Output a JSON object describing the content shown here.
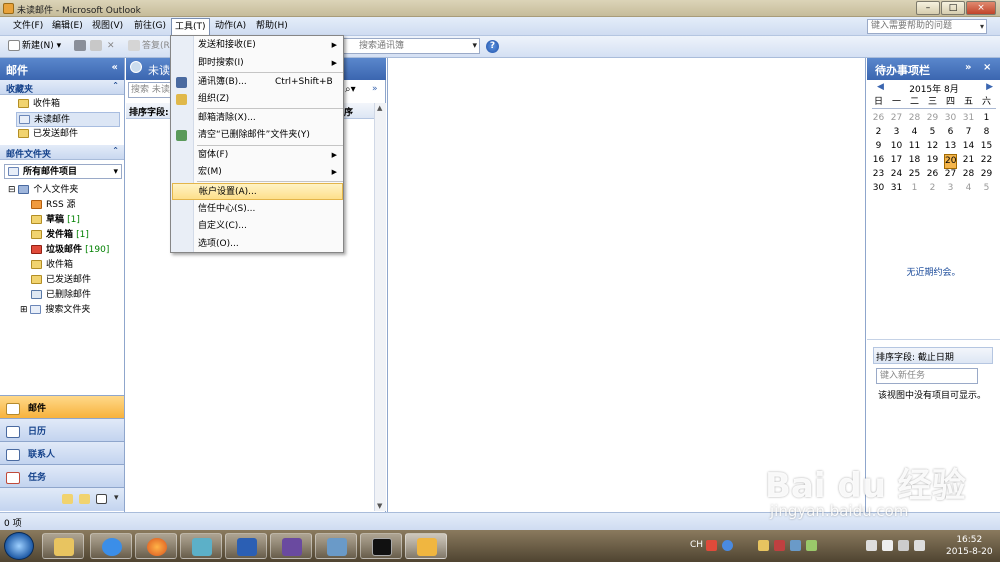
{
  "window": {
    "title": "未读邮件 - Microsoft Outlook",
    "min": "–",
    "max": "□",
    "close": "×"
  },
  "menubar": {
    "items": [
      "文件(F)",
      "编辑(E)",
      "视图(V)",
      "前往(G)",
      "工具(T)",
      "动作(A)",
      "帮助(H)"
    ],
    "help_placeholder": "键入需要帮助的问题"
  },
  "toolbar": {
    "new_label": "新建(N)",
    "reply_label": "答复(R)",
    "search_address": "搜索通讯簿"
  },
  "nav": {
    "title": "邮件",
    "favorites_title": "收藏夹",
    "favorites": [
      "收件箱",
      "未读邮件",
      "已发送邮件"
    ],
    "folders_title": "邮件文件夹",
    "all_items": "所有邮件项目",
    "personal": "个人文件夹",
    "folders": [
      {
        "name": "RSS 源",
        "count": ""
      },
      {
        "name": "草稿",
        "count": "[1]"
      },
      {
        "name": "发件箱",
        "count": "[1]"
      },
      {
        "name": "垃圾邮件",
        "count": "[190]"
      },
      {
        "name": "收件箱",
        "count": ""
      },
      {
        "name": "已发送邮件",
        "count": ""
      },
      {
        "name": "已删除邮件",
        "count": ""
      },
      {
        "name": "搜索文件夹",
        "count": ""
      }
    ],
    "buttons": [
      "邮件",
      "日历",
      "联系人",
      "任务"
    ]
  },
  "list": {
    "title": "未读",
    "search_placeholder": "搜索 未读",
    "sort_label": "排序字段:",
    "sort_right": "序"
  },
  "tools_menu": {
    "items": [
      {
        "label": "发送和接收(E)",
        "shortcut": "",
        "submenu": true
      },
      {
        "label": "即时搜索(I)",
        "shortcut": "",
        "submenu": true
      },
      {
        "label": "通讯簿(B)...",
        "shortcut": "Ctrl+Shift+B",
        "submenu": false
      },
      {
        "label": "组织(Z)",
        "shortcut": "",
        "submenu": false
      },
      {
        "label": "邮箱清除(X)...",
        "shortcut": "",
        "submenu": false
      },
      {
        "label": "清空“已删除邮件”文件夹(Y)",
        "shortcut": "",
        "submenu": false
      },
      {
        "label": "窗体(F)",
        "shortcut": "",
        "submenu": true
      },
      {
        "label": "宏(M)",
        "shortcut": "",
        "submenu": true
      },
      {
        "label": "帐户设置(A)...",
        "shortcut": "",
        "submenu": false
      },
      {
        "label": "信任中心(S)...",
        "shortcut": "",
        "submenu": false
      },
      {
        "label": "自定义(C)...",
        "shortcut": "",
        "submenu": false
      },
      {
        "label": "选项(O)...",
        "shortcut": "",
        "submenu": false
      }
    ]
  },
  "todo": {
    "title": "待办事项栏",
    "month": "2015年 8月",
    "weekdays": [
      "日",
      "一",
      "二",
      "三",
      "四",
      "五",
      "六"
    ],
    "weeks": [
      [
        "26",
        "27",
        "28",
        "29",
        "30",
        "31",
        "1"
      ],
      [
        "2",
        "3",
        "4",
        "5",
        "6",
        "7",
        "8"
      ],
      [
        "9",
        "10",
        "11",
        "12",
        "13",
        "14",
        "15"
      ],
      [
        "16",
        "17",
        "18",
        "19",
        "20",
        "21",
        "22"
      ],
      [
        "23",
        "24",
        "25",
        "26",
        "27",
        "28",
        "29"
      ],
      [
        "30",
        "31",
        "1",
        "2",
        "3",
        "4",
        "5"
      ]
    ],
    "no_appointments": "无近期约会。",
    "task_sort": "排序字段: 截止日期",
    "new_task_placeholder": "键入新任务",
    "no_items": "该视图中没有项目可显示。"
  },
  "statusbar": {
    "text": "0 项"
  },
  "taskbar": {
    "lang": "CH",
    "time": "16:52",
    "date": "2015-8-20"
  },
  "watermark": {
    "brand": "Bai du 经验",
    "url": "jingyan.baidu.com"
  },
  "colors": {
    "accent": "#3b66b0",
    "highlight": "#fddf8b",
    "today": "#f5b54a"
  }
}
